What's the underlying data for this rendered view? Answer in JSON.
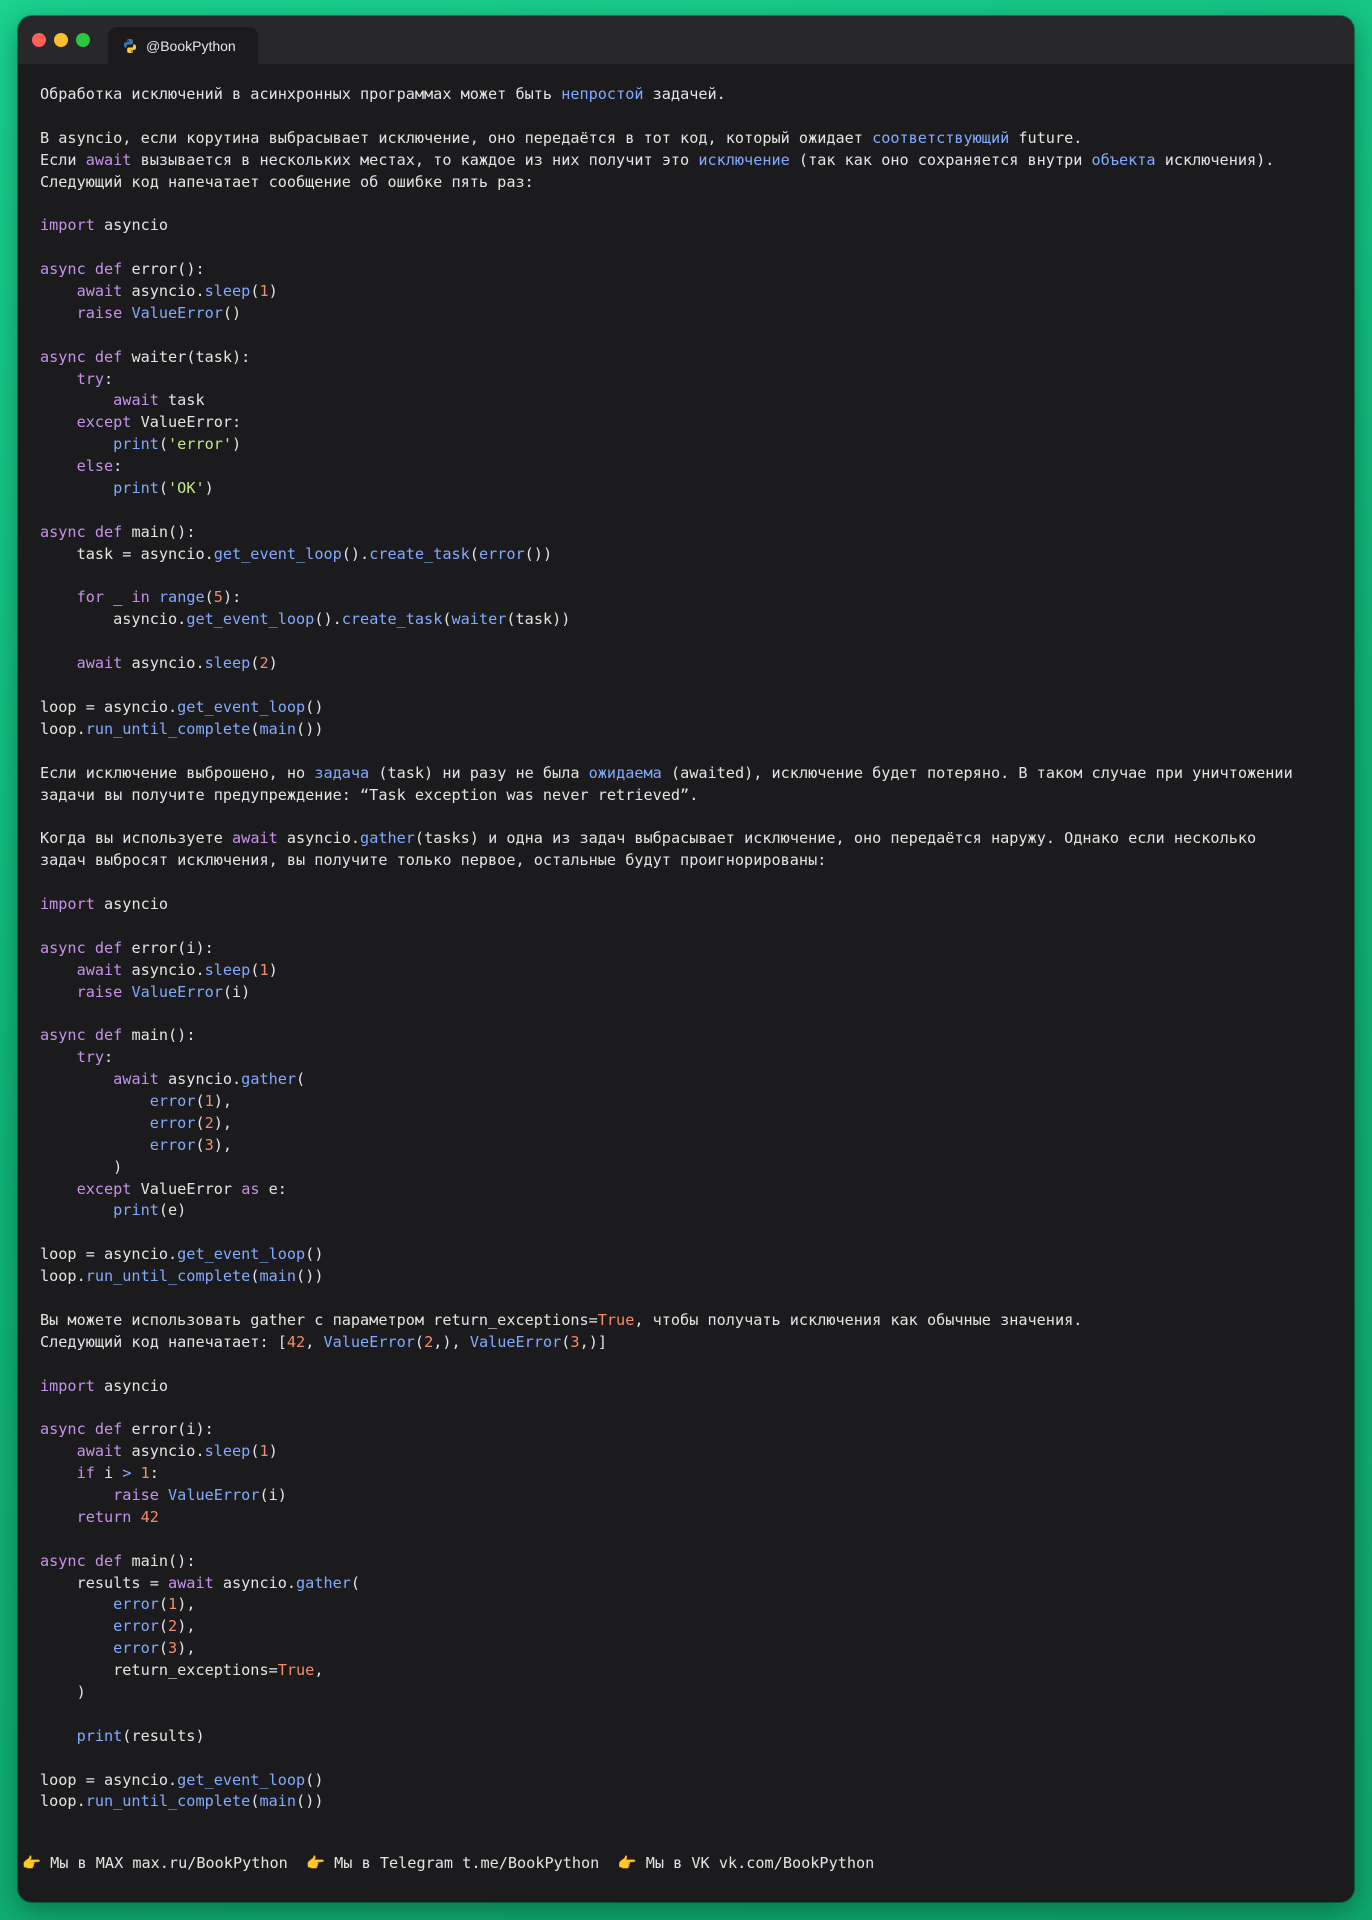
{
  "window": {
    "tab_label": "@BookPython"
  },
  "content": {
    "intro": [
      [
        [
          "Обработка исключений в асинхронных программах может быть ",
          ""
        ],
        [
          "непростой",
          "hl"
        ],
        [
          " задачей.",
          ""
        ]
      ],
      [],
      [
        [
          "В asyncio, если корутина выбрасывает исключение, оно передаётся в тот код, который ожидает ",
          ""
        ],
        [
          "соответствующий",
          "hl"
        ],
        [
          " future.",
          ""
        ]
      ],
      [
        [
          "Если ",
          ""
        ],
        [
          "await",
          "kw"
        ],
        [
          " вызывается в нескольких местах, то каждое из них получит это ",
          ""
        ],
        [
          "исключение",
          "hl"
        ],
        [
          " (так как оно сохраняется внутри ",
          ""
        ],
        [
          "объекта",
          "hl"
        ],
        [
          " исключения).",
          ""
        ]
      ],
      [
        [
          "Следующий код напечатает сообщение об ошибке пять раз:",
          ""
        ]
      ]
    ],
    "code1": [
      [
        [
          "import",
          "kw"
        ],
        [
          " asyncio",
          ""
        ]
      ],
      [],
      [
        [
          "async",
          "kw"
        ],
        [
          " ",
          ""
        ],
        [
          "def",
          "kw"
        ],
        [
          " error():",
          ""
        ]
      ],
      [
        [
          "    ",
          ""
        ],
        [
          "await",
          "kw"
        ],
        [
          " asyncio.",
          ""
        ],
        [
          "sleep",
          "fn"
        ],
        [
          "(",
          ""
        ],
        [
          "1",
          "num"
        ],
        [
          ")",
          ""
        ]
      ],
      [
        [
          "    ",
          ""
        ],
        [
          "raise",
          "kw"
        ],
        [
          " ",
          ""
        ],
        [
          "ValueError",
          "fn"
        ],
        [
          "()",
          ""
        ]
      ],
      [],
      [
        [
          "async",
          "kw"
        ],
        [
          " ",
          ""
        ],
        [
          "def",
          "kw"
        ],
        [
          " waiter(task):",
          ""
        ]
      ],
      [
        [
          "    ",
          ""
        ],
        [
          "try",
          "kw"
        ],
        [
          ":",
          ""
        ]
      ],
      [
        [
          "        ",
          ""
        ],
        [
          "await",
          "kw"
        ],
        [
          " task",
          ""
        ]
      ],
      [
        [
          "    ",
          ""
        ],
        [
          "except",
          "kw"
        ],
        [
          " ValueError:",
          ""
        ]
      ],
      [
        [
          "        ",
          ""
        ],
        [
          "print",
          "fn"
        ],
        [
          "(",
          ""
        ],
        [
          "'error'",
          "str"
        ],
        [
          ")",
          ""
        ]
      ],
      [
        [
          "    ",
          ""
        ],
        [
          "else",
          "kw"
        ],
        [
          ":",
          ""
        ]
      ],
      [
        [
          "        ",
          ""
        ],
        [
          "print",
          "fn"
        ],
        [
          "(",
          ""
        ],
        [
          "'OK'",
          "str"
        ],
        [
          ")",
          ""
        ]
      ],
      [],
      [
        [
          "async",
          "kw"
        ],
        [
          " ",
          ""
        ],
        [
          "def",
          "kw"
        ],
        [
          " main():",
          ""
        ]
      ],
      [
        [
          "    task = asyncio.",
          ""
        ],
        [
          "get_event_loop",
          "fn"
        ],
        [
          "().",
          ""
        ],
        [
          "create_task",
          "fn"
        ],
        [
          "(",
          ""
        ],
        [
          "error",
          "fn"
        ],
        [
          "())",
          ""
        ]
      ],
      [],
      [
        [
          "    ",
          ""
        ],
        [
          "for",
          "kw"
        ],
        [
          " _ ",
          ""
        ],
        [
          "in",
          "kw"
        ],
        [
          " ",
          ""
        ],
        [
          "range",
          "fn"
        ],
        [
          "(",
          ""
        ],
        [
          "5",
          "num"
        ],
        [
          "):",
          ""
        ]
      ],
      [
        [
          "        asyncio.",
          ""
        ],
        [
          "get_event_loop",
          "fn"
        ],
        [
          "().",
          ""
        ],
        [
          "create_task",
          "fn"
        ],
        [
          "(",
          ""
        ],
        [
          "waiter",
          "fn"
        ],
        [
          "(task))",
          ""
        ]
      ],
      [],
      [
        [
          "    ",
          ""
        ],
        [
          "await",
          "kw"
        ],
        [
          " asyncio.",
          ""
        ],
        [
          "sleep",
          "fn"
        ],
        [
          "(",
          ""
        ],
        [
          "2",
          "num"
        ],
        [
          ")",
          ""
        ]
      ],
      [],
      [
        [
          "loop = asyncio.",
          ""
        ],
        [
          "get_event_loop",
          "fn"
        ],
        [
          "()",
          ""
        ]
      ],
      [
        [
          "loop.",
          ""
        ],
        [
          "run_until_complete",
          "fn"
        ],
        [
          "(",
          ""
        ],
        [
          "main",
          "fn"
        ],
        [
          "())",
          ""
        ]
      ],
      [],
      [
        [
          "Если исключение выброшено, но ",
          ""
        ],
        [
          "задача",
          "hl"
        ],
        [
          " (task) ни разу не была ",
          ""
        ],
        [
          "ожидаема",
          "hl"
        ],
        [
          " (awaited), исключение будет потеряно. В таком случае при уничтожении",
          ""
        ]
      ],
      [
        [
          "задачи вы получите предупреждение: “Task exception was never retrieved”.",
          ""
        ]
      ],
      [],
      [
        [
          "Когда вы используете ",
          ""
        ],
        [
          "await",
          "kw"
        ],
        [
          " asyncio.",
          ""
        ],
        [
          "gather",
          "fn"
        ],
        [
          "(tasks) и одна из задач выбрасывает исключение, оно передаётся наружу. Однако если несколько",
          ""
        ]
      ],
      [
        [
          "задач выбросят исключения, вы получите только первое, остальные будут проигнорированы:",
          ""
        ]
      ],
      [],
      [
        [
          "import",
          "kw"
        ],
        [
          " asyncio",
          ""
        ]
      ],
      [],
      [
        [
          "async",
          "kw"
        ],
        [
          " ",
          ""
        ],
        [
          "def",
          "kw"
        ],
        [
          " error(i):",
          ""
        ]
      ],
      [
        [
          "    ",
          ""
        ],
        [
          "await",
          "kw"
        ],
        [
          " asyncio.",
          ""
        ],
        [
          "sleep",
          "fn"
        ],
        [
          "(",
          ""
        ],
        [
          "1",
          "num"
        ],
        [
          ")",
          ""
        ]
      ],
      [
        [
          "    ",
          ""
        ],
        [
          "raise",
          "kw"
        ],
        [
          " ",
          ""
        ],
        [
          "ValueError",
          "fn"
        ],
        [
          "(i)",
          ""
        ]
      ],
      [],
      [
        [
          "async",
          "kw"
        ],
        [
          " ",
          ""
        ],
        [
          "def",
          "kw"
        ],
        [
          " main():",
          ""
        ]
      ],
      [
        [
          "    ",
          ""
        ],
        [
          "try",
          "kw"
        ],
        [
          ":",
          ""
        ]
      ],
      [
        [
          "        ",
          ""
        ],
        [
          "await",
          "kw"
        ],
        [
          " asyncio.",
          ""
        ],
        [
          "gather",
          "fn"
        ],
        [
          "(",
          ""
        ]
      ],
      [
        [
          "            ",
          ""
        ],
        [
          "error",
          "fn"
        ],
        [
          "(",
          ""
        ],
        [
          "1",
          "num"
        ],
        [
          "),",
          ""
        ]
      ],
      [
        [
          "            ",
          ""
        ],
        [
          "error",
          "fn"
        ],
        [
          "(",
          ""
        ],
        [
          "2",
          "num"
        ],
        [
          "),",
          ""
        ]
      ],
      [
        [
          "            ",
          ""
        ],
        [
          "error",
          "fn"
        ],
        [
          "(",
          ""
        ],
        [
          "3",
          "num"
        ],
        [
          "),",
          ""
        ]
      ],
      [
        [
          "        )",
          ""
        ]
      ],
      [
        [
          "    ",
          ""
        ],
        [
          "except",
          "kw"
        ],
        [
          " ValueError ",
          ""
        ],
        [
          "as",
          "kw"
        ],
        [
          " e:",
          ""
        ]
      ],
      [
        [
          "        ",
          ""
        ],
        [
          "print",
          "fn"
        ],
        [
          "(e)",
          ""
        ]
      ],
      [],
      [
        [
          "loop = asyncio.",
          ""
        ],
        [
          "get_event_loop",
          "fn"
        ],
        [
          "()",
          ""
        ]
      ],
      [
        [
          "loop.",
          ""
        ],
        [
          "run_until_complete",
          "fn"
        ],
        [
          "(",
          ""
        ],
        [
          "main",
          "fn"
        ],
        [
          "())",
          ""
        ]
      ],
      [],
      [
        [
          "Вы можете использовать gather с параметром return_exceptions=",
          ""
        ],
        [
          "True",
          "num"
        ],
        [
          ", чтобы получать исключения как обычные значения.",
          ""
        ]
      ],
      [
        [
          "Следующий код напечатает: [",
          ""
        ],
        [
          "42",
          "num"
        ],
        [
          ", ",
          ""
        ],
        [
          "ValueError",
          "fn"
        ],
        [
          "(",
          ""
        ],
        [
          "2",
          "num"
        ],
        [
          ",), ",
          ""
        ],
        [
          "ValueError",
          "fn"
        ],
        [
          "(",
          ""
        ],
        [
          "3",
          "num"
        ],
        [
          ",)]",
          ""
        ]
      ],
      [],
      [
        [
          "import",
          "kw"
        ],
        [
          " asyncio",
          ""
        ]
      ],
      [],
      [
        [
          "async",
          "kw"
        ],
        [
          " ",
          ""
        ],
        [
          "def",
          "kw"
        ],
        [
          " error(i):",
          ""
        ]
      ],
      [
        [
          "    ",
          ""
        ],
        [
          "await",
          "kw"
        ],
        [
          " asyncio.",
          ""
        ],
        [
          "sleep",
          "fn"
        ],
        [
          "(",
          ""
        ],
        [
          "1",
          "num"
        ],
        [
          ")",
          ""
        ]
      ],
      [
        [
          "    ",
          ""
        ],
        [
          "if",
          "kw"
        ],
        [
          " i ",
          ""
        ],
        [
          ">",
          "fn"
        ],
        [
          " ",
          ""
        ],
        [
          "1",
          "num"
        ],
        [
          ":",
          ""
        ]
      ],
      [
        [
          "        ",
          ""
        ],
        [
          "raise",
          "kw"
        ],
        [
          " ",
          ""
        ],
        [
          "ValueError",
          "fn"
        ],
        [
          "(i)",
          ""
        ]
      ],
      [
        [
          "    ",
          ""
        ],
        [
          "return",
          "kw"
        ],
        [
          " ",
          ""
        ],
        [
          "42",
          "num"
        ]
      ],
      [],
      [
        [
          "async",
          "kw"
        ],
        [
          " ",
          ""
        ],
        [
          "def",
          "kw"
        ],
        [
          " main():",
          ""
        ]
      ],
      [
        [
          "    results = ",
          ""
        ],
        [
          "await",
          "kw"
        ],
        [
          " asyncio.",
          ""
        ],
        [
          "gather",
          "fn"
        ],
        [
          "(",
          ""
        ]
      ],
      [
        [
          "        ",
          ""
        ],
        [
          "error",
          "fn"
        ],
        [
          "(",
          ""
        ],
        [
          "1",
          "num"
        ],
        [
          "),",
          ""
        ]
      ],
      [
        [
          "        ",
          ""
        ],
        [
          "error",
          "fn"
        ],
        [
          "(",
          ""
        ],
        [
          "2",
          "num"
        ],
        [
          "),",
          ""
        ]
      ],
      [
        [
          "        ",
          ""
        ],
        [
          "error",
          "fn"
        ],
        [
          "(",
          ""
        ],
        [
          "3",
          "num"
        ],
        [
          "),",
          ""
        ]
      ],
      [
        [
          "        return_exceptions=",
          ""
        ],
        [
          "True",
          "num"
        ],
        [
          ",",
          ""
        ]
      ],
      [
        [
          "    )",
          ""
        ]
      ],
      [],
      [
        [
          "    ",
          ""
        ],
        [
          "print",
          "fn"
        ],
        [
          "(results)",
          ""
        ]
      ],
      [],
      [
        [
          "loop = asyncio.",
          ""
        ],
        [
          "get_event_loop",
          "fn"
        ],
        [
          "()",
          ""
        ]
      ],
      [
        [
          "loop.",
          ""
        ],
        [
          "run_until_complete",
          "fn"
        ],
        [
          "(",
          ""
        ],
        [
          "main",
          "fn"
        ],
        [
          "())",
          ""
        ]
      ]
    ]
  },
  "footer": {
    "links": [
      {
        "icon": "pointing-finger-icon",
        "text": "Мы в MAX max.ru/BookPython"
      },
      {
        "icon": "pointing-finger-icon",
        "text": "Мы в Telegram t.me/BookPython"
      },
      {
        "icon": "pointing-finger-icon",
        "text": "Мы в VK vk.com/BookPython"
      }
    ]
  },
  "colors": {
    "keyword": "#c792ea",
    "function": "#82aaff",
    "number": "#f78c6c",
    "string": "#c3e88d",
    "text": "#e4e4e4",
    "background": "#1b1b1d"
  }
}
